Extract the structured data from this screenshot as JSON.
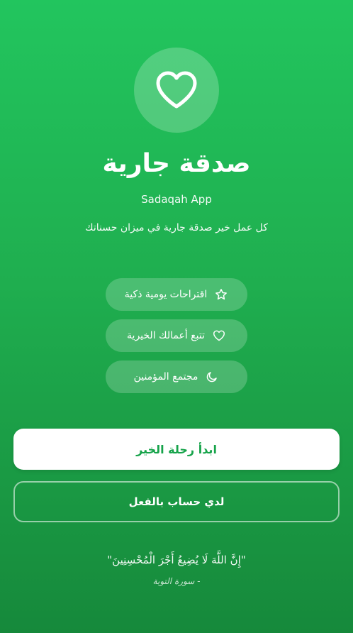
{
  "app": {
    "title": "صدقة جارية",
    "subtitle": "Sadaqah App",
    "tagline": "كل عمل خير صدقة جارية في ميزان حسناتك",
    "logo_icon": "heart-icon"
  },
  "features": [
    {
      "label": "اقتراحات يومية ذكية",
      "icon": "star-icon"
    },
    {
      "label": "تتبع أعمالك الخيرية",
      "icon": "heart-icon"
    },
    {
      "label": "مجتمع المؤمنين",
      "icon": "moon-icon"
    }
  ],
  "actions": {
    "primary_label": "ابدأ رحلة الخير",
    "secondary_label": "لدي حساب بالفعل"
  },
  "quote": {
    "text": "\"إِنَّ اللَّهَ لَا يُضِيعُ أَجْرَ الْمُحْسِنِينَ\"",
    "source": "- سورة التوبة"
  },
  "colors": {
    "background_top": "#22c55e",
    "background_bottom": "#16893b",
    "primary_button_text": "#16a34a",
    "primary_button_bg": "#ffffff"
  }
}
